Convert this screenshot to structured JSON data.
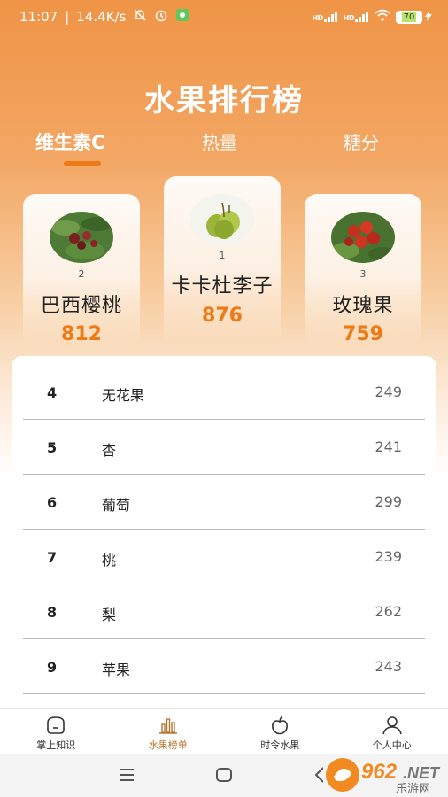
{
  "status_bar": {
    "time": "11:07",
    "speed": "14.4K/s",
    "signal1": "HD",
    "signal2": "HD",
    "battery": "70"
  },
  "page": {
    "title": "水果排行榜"
  },
  "tabs": [
    {
      "label": "维生素C",
      "active": true
    },
    {
      "label": "热量",
      "active": false
    },
    {
      "label": "糖分",
      "active": false
    }
  ],
  "podium": [
    {
      "rank": "2",
      "name": "巴西樱桃",
      "value": "812",
      "image": "brazil-cherry-photo"
    },
    {
      "rank": "1",
      "name": "卡卡杜李子",
      "value": "876",
      "image": "kakadu-plum-photo"
    },
    {
      "rank": "3",
      "name": "玫瑰果",
      "value": "759",
      "image": "rose-hip-photo"
    }
  ],
  "list": [
    {
      "rank": "4",
      "name": "无花果",
      "value": "249"
    },
    {
      "rank": "5",
      "name": "杏",
      "value": "241"
    },
    {
      "rank": "6",
      "name": "葡萄",
      "value": "299"
    },
    {
      "rank": "7",
      "name": "桃",
      "value": "239"
    },
    {
      "rank": "8",
      "name": "梨",
      "value": "262"
    },
    {
      "rank": "9",
      "name": "苹果",
      "value": "243"
    }
  ],
  "bottom_nav": [
    {
      "label": "掌上知识",
      "icon": "chat-icon",
      "active": false
    },
    {
      "label": "水果榜单",
      "icon": "bar-chart-icon",
      "active": true
    },
    {
      "label": "时令水果",
      "icon": "apple-icon",
      "active": false
    },
    {
      "label": "个人中心",
      "icon": "person-icon",
      "active": false
    }
  ],
  "watermark": {
    "brand": "962.NET",
    "sub": "乐游网"
  },
  "colors": {
    "accent": "#ee7a16",
    "header_top": "#ef9446",
    "active_nav": "#b3762e"
  }
}
